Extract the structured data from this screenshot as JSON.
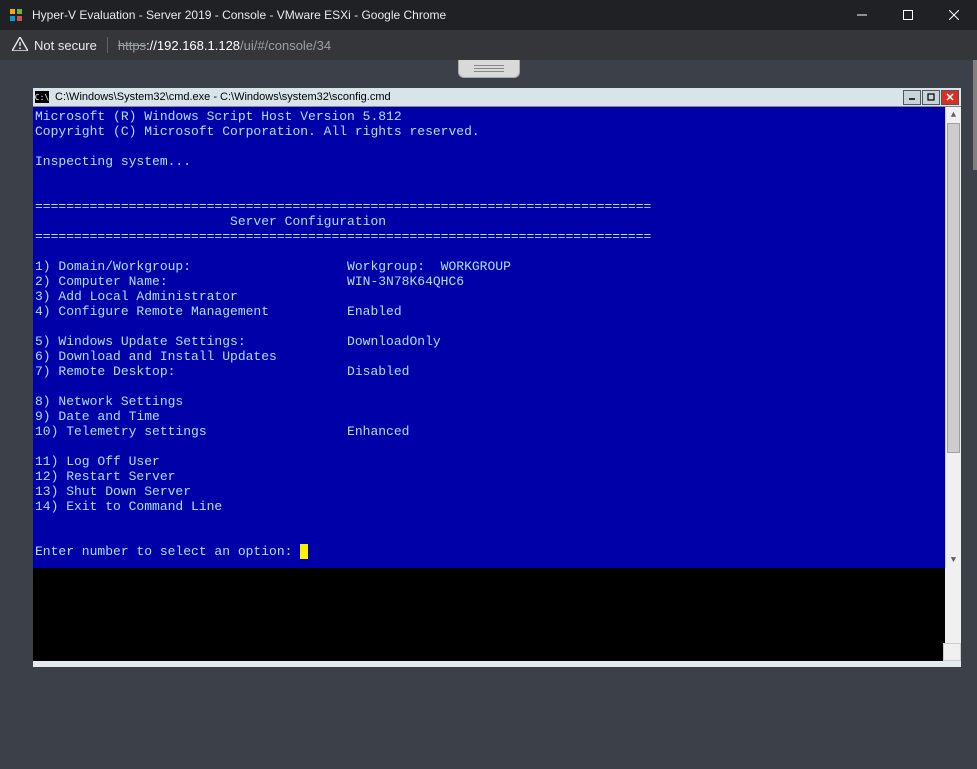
{
  "chrome": {
    "title": "Hyper-V Evaluation - Server 2019 - Console - VMware ESXi - Google Chrome",
    "security_label": "Not secure",
    "url_scheme": "https",
    "url_host": "://192.168.1.128",
    "url_path": "/ui/#/console/34"
  },
  "cmd": {
    "title": "C:\\Windows\\System32\\cmd.exe - C:\\Windows\\system32\\sconfig.cmd",
    "header1": "Microsoft (R) Windows Script Host Version 5.812",
    "header2": "Copyright (C) Microsoft Corporation. All rights reserved.",
    "inspecting": "Inspecting system...",
    "rule": "===============================================================================",
    "banner": "                         Server Configuration",
    "items": [
      {
        "num": "1)",
        "label": "Domain/Workgroup:",
        "value": "Workgroup:  WORKGROUP"
      },
      {
        "num": "2)",
        "label": "Computer Name:",
        "value": "WIN-3N78K64QHC6"
      },
      {
        "num": "3)",
        "label": "Add Local Administrator",
        "value": ""
      },
      {
        "num": "4)",
        "label": "Configure Remote Management",
        "value": "Enabled"
      },
      {
        "num": "",
        "label": "",
        "value": ""
      },
      {
        "num": "5)",
        "label": "Windows Update Settings:",
        "value": "DownloadOnly"
      },
      {
        "num": "6)",
        "label": "Download and Install Updates",
        "value": ""
      },
      {
        "num": "7)",
        "label": "Remote Desktop:",
        "value": "Disabled"
      },
      {
        "num": "",
        "label": "",
        "value": ""
      },
      {
        "num": "8)",
        "label": "Network Settings",
        "value": ""
      },
      {
        "num": "9)",
        "label": "Date and Time",
        "value": ""
      },
      {
        "num": "10)",
        "label": "Telemetry settings",
        "value": "Enhanced"
      },
      {
        "num": "",
        "label": "",
        "value": ""
      },
      {
        "num": "11)",
        "label": "Log Off User",
        "value": ""
      },
      {
        "num": "12)",
        "label": "Restart Server",
        "value": ""
      },
      {
        "num": "13)",
        "label": "Shut Down Server",
        "value": ""
      },
      {
        "num": "14)",
        "label": "Exit to Command Line",
        "value": ""
      }
    ],
    "prompt": "Enter number to select an option: "
  }
}
